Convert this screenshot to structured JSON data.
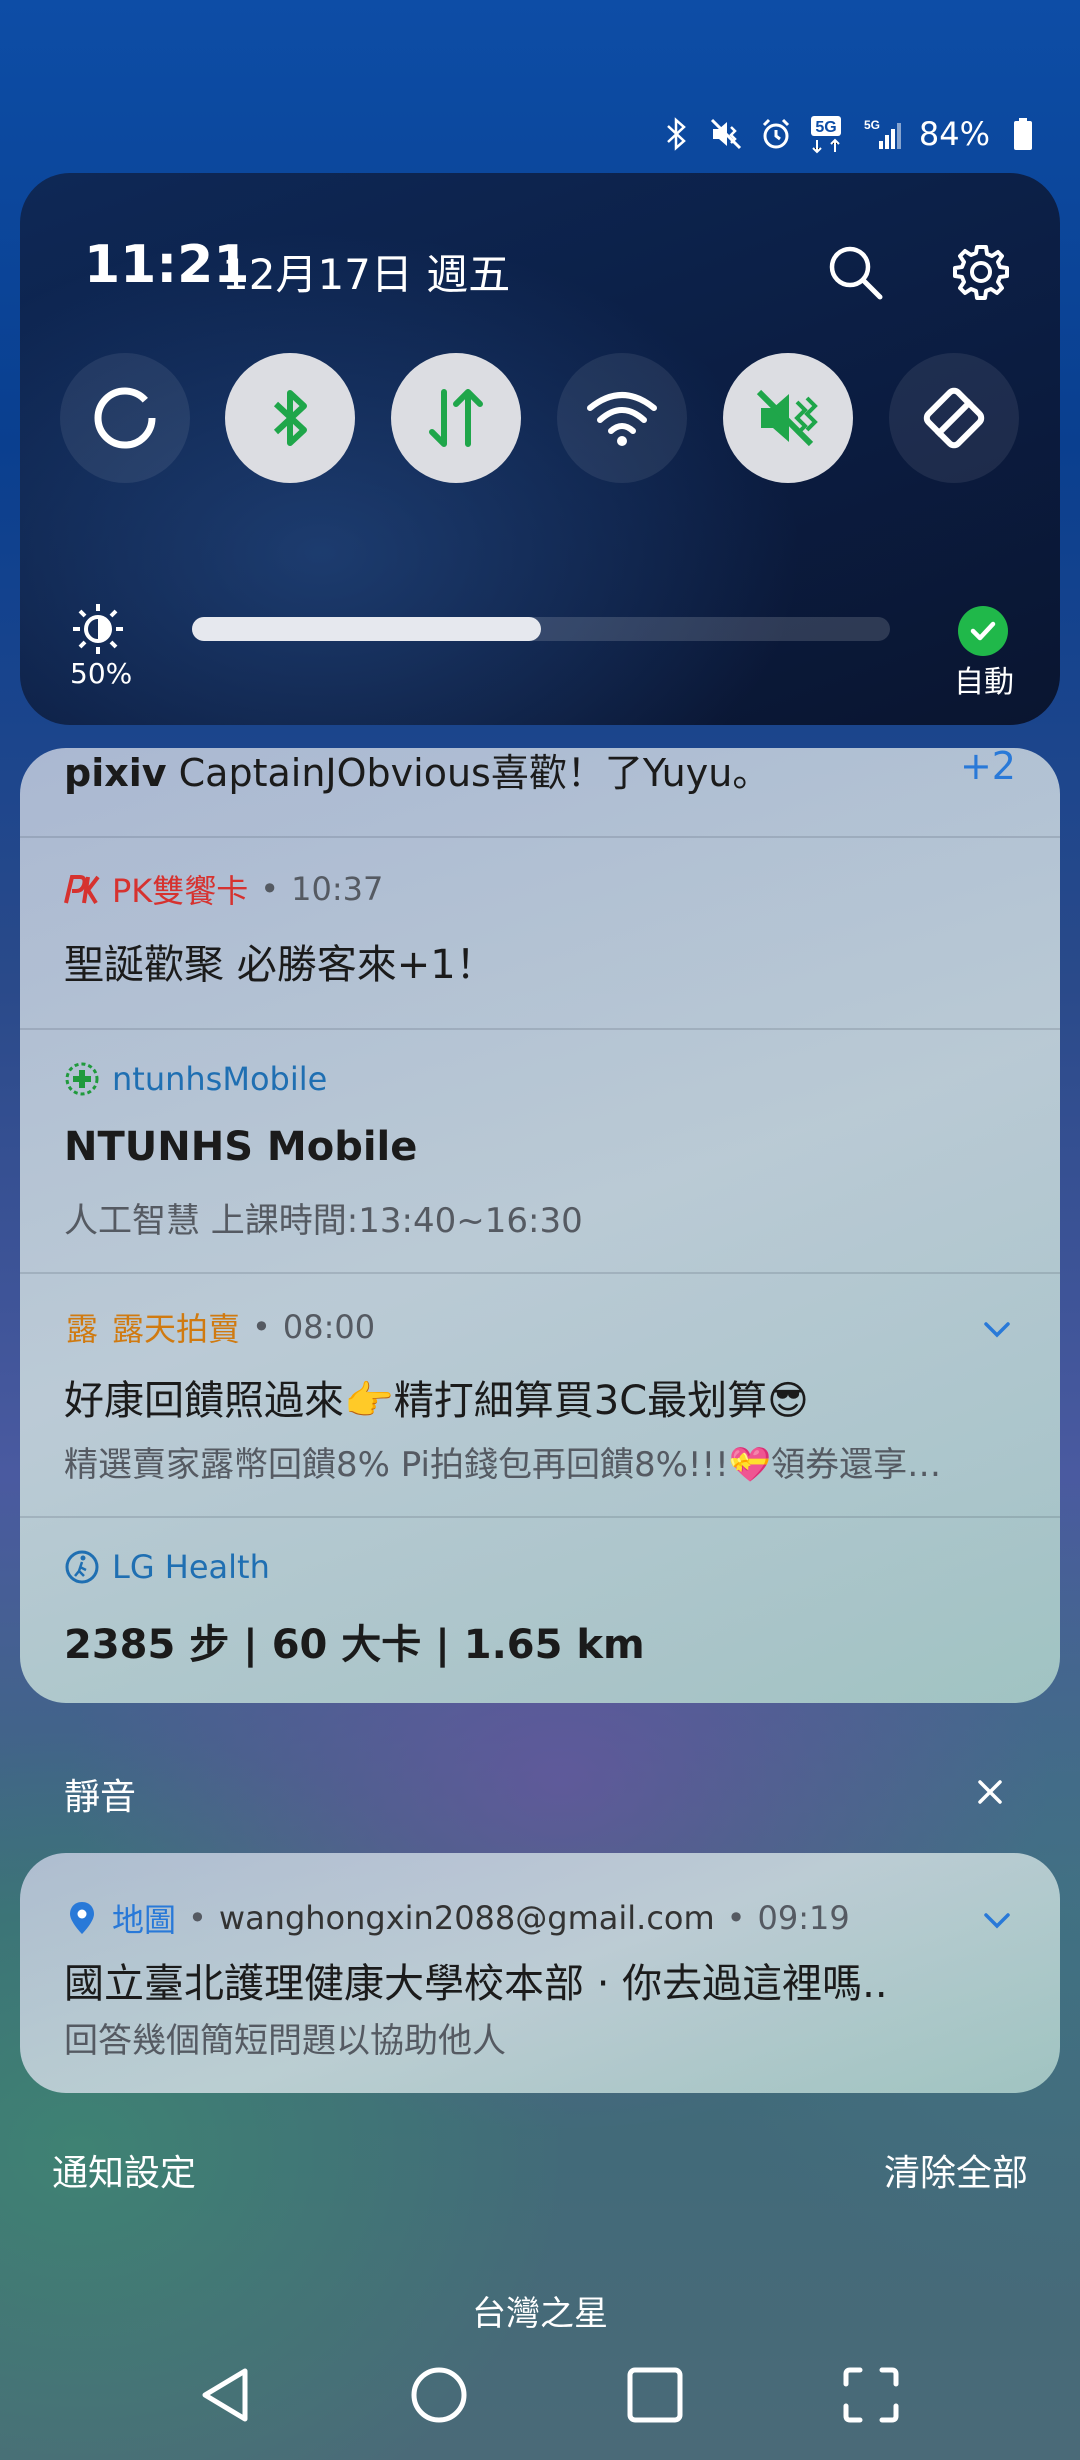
{
  "status_bar": {
    "icons": [
      "bluetooth-icon",
      "vibrate-mute-icon",
      "alarm-icon",
      "5g-data-icon",
      "5g-signal-icon",
      "battery-icon"
    ],
    "net_label": "5G",
    "battery": "84%"
  },
  "quick_settings": {
    "time": "11:21",
    "date": "12月17日 週五",
    "tiles": [
      {
        "name": "data-saver",
        "icon": "circle-ring-icon",
        "active": false
      },
      {
        "name": "bluetooth",
        "icon": "bluetooth-icon",
        "active": true
      },
      {
        "name": "mobile-data",
        "icon": "data-arrows-icon",
        "active": true
      },
      {
        "name": "wifi",
        "icon": "wifi-icon",
        "active": false
      },
      {
        "name": "sound",
        "icon": "vibrate-mute-icon",
        "active": true
      },
      {
        "name": "auto-rotate",
        "icon": "rotate-icon",
        "active": false
      }
    ],
    "brightness": {
      "percent_label": "50%",
      "level": 0.5
    },
    "auto_label": "自動",
    "accent": "#20b84a"
  },
  "notifications": [
    {
      "app": "pixiv",
      "text": "CaptainJObvious喜歡！了Yuyu。",
      "count": "+2"
    },
    {
      "app": "PK雙饗卡",
      "time": "10:37",
      "title": "聖誕歡聚 必勝客來+1！",
      "app_color": "#d6322f"
    },
    {
      "app": "ntunhsMobile",
      "title": "NTUNHS Mobile",
      "body": "人工智慧 上課時間:13:40~16:30",
      "app_color": "#1f6fb2"
    },
    {
      "app": "露天拍賣",
      "icon_text": "露",
      "time": "08:00",
      "title": "好康回饋照過來👉精打細算買3C最划算😎",
      "body": "精選賣家露幣回饋8% Pi拍錢包再回饋8%!!!💝領券還享…",
      "app_color": "#d07a10"
    },
    {
      "app": "LG Health",
      "title": "2385 步 | 60 大卡 | 1.65 km",
      "app_color": "#1f6fb2"
    }
  ],
  "silent_section": {
    "label": "靜音",
    "notification": {
      "app": "地圖",
      "account": "wanghongxin2088@gmail.com",
      "time": "09:19",
      "title": "國立臺北護理健康大學校本部 · 你去過這裡嗎..",
      "body": "回答幾個簡短問題以協助他人"
    }
  },
  "footer": {
    "settings_label": "通知設定",
    "clear_label": "清除全部",
    "carrier": "台灣之星"
  },
  "nav": [
    "back-icon",
    "home-icon",
    "recents-icon",
    "screenshot-icon"
  ]
}
